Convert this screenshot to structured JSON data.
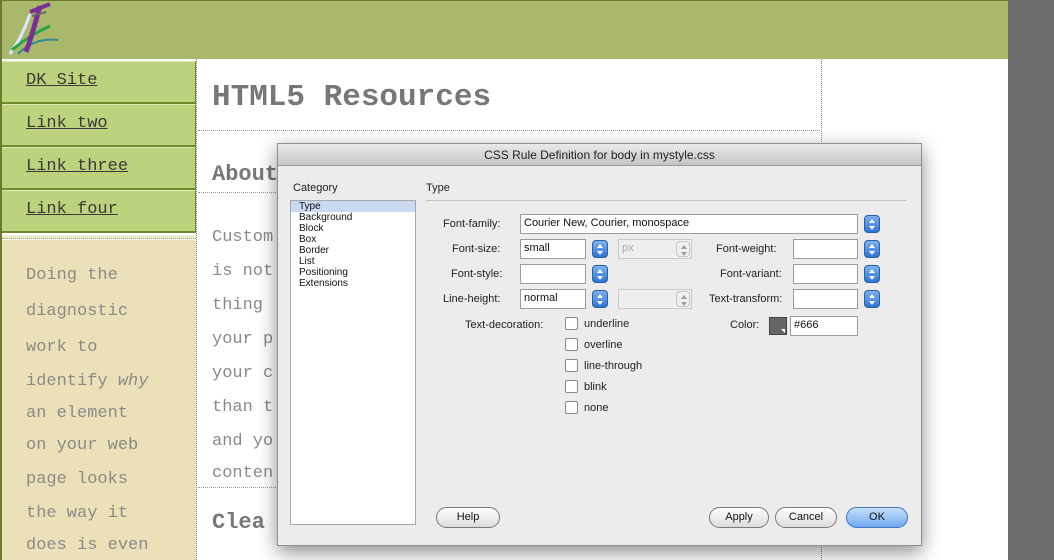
{
  "page": {
    "nav": [
      "DK Site",
      "Link two",
      "Link three",
      "Link four"
    ],
    "aside": {
      "lines": [
        "Doing the",
        "diagnostic",
        "work to",
        "identify ",
        "an element",
        "on your web",
        "page looks",
        "the way it",
        "does is even"
      ],
      "emphasis_word": "why"
    },
    "title": "HTML5 Resources",
    "about_heading": "About",
    "body_lines": [
      "Custom",
      "is not",
      "thing",
      "your p",
      "your c",
      "than t",
      "and yo",
      "conten"
    ],
    "next_heading": "Clea"
  },
  "dialog": {
    "title": "CSS Rule Definition for body in mystyle.css",
    "category_heading": "Category",
    "categories": [
      "Type",
      "Background",
      "Block",
      "Box",
      "Border",
      "List",
      "Positioning",
      "Extensions"
    ],
    "selected_category": "Type",
    "panel_heading": "Type",
    "font_family": {
      "label": "Font-family:",
      "value": "Courier New, Courier, monospace"
    },
    "font_size": {
      "label": "Font-size:",
      "value": "small",
      "unit": "px"
    },
    "font_weight": {
      "label": "Font-weight:",
      "value": ""
    },
    "font_style": {
      "label": "Font-style:",
      "value": ""
    },
    "font_variant": {
      "label": "Font-variant:",
      "value": ""
    },
    "line_height": {
      "label": "Line-height:",
      "value": "normal",
      "unit": ""
    },
    "text_transform": {
      "label": "Text-transform:",
      "value": ""
    },
    "text_decoration": {
      "label": "Text-decoration:",
      "options": [
        "underline",
        "overline",
        "line-through",
        "blink",
        "none"
      ]
    },
    "color": {
      "label": "Color:",
      "value": "#666",
      "swatch": "#666666"
    },
    "buttons": {
      "help": "Help",
      "apply": "Apply",
      "cancel": "Cancel",
      "ok": "OK"
    }
  }
}
